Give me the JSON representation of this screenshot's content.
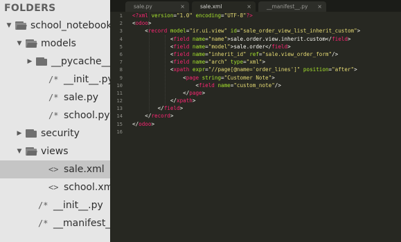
{
  "sidebar": {
    "header": "FOLDERS",
    "items": [
      {
        "label": "school_notebook",
        "type": "folder",
        "expanded": true
      },
      {
        "label": "models",
        "type": "folder",
        "expanded": true
      },
      {
        "label": "__pycache__",
        "type": "folder",
        "expanded": false
      },
      {
        "label": "__init__.py",
        "type": "file",
        "glyph": "/*"
      },
      {
        "label": "sale.py",
        "type": "file",
        "glyph": "/*"
      },
      {
        "label": "school.py",
        "type": "file",
        "glyph": "/*"
      },
      {
        "label": "security",
        "type": "folder",
        "expanded": false
      },
      {
        "label": "views",
        "type": "folder",
        "expanded": true
      },
      {
        "label": "sale.xml",
        "type": "file",
        "glyph": "<>",
        "selected": true
      },
      {
        "label": "school.xml",
        "type": "file",
        "glyph": "<>"
      },
      {
        "label": "__init__.py",
        "type": "file",
        "glyph": "/*"
      },
      {
        "label": "__manifest__.py",
        "type": "file",
        "glyph": "/*"
      }
    ]
  },
  "tabs": [
    {
      "label": "sale.py",
      "close": "×",
      "active": false
    },
    {
      "label": "sale.xml",
      "close": "×",
      "active": true
    },
    {
      "label": "__manifest__.py",
      "close": "×",
      "active": false
    }
  ],
  "editor": {
    "line_numbers": [
      "1",
      "2",
      "3",
      "4",
      "5",
      "6",
      "7",
      "8",
      "9",
      "10",
      "11",
      "12",
      "13",
      "14",
      "15",
      "16"
    ],
    "lines": [
      [
        [
          "tg",
          "<?xml "
        ],
        [
          "at",
          "version"
        ],
        [
          "pu",
          "="
        ],
        [
          "st",
          "\"1.0\""
        ],
        [
          "pu",
          " "
        ],
        [
          "at",
          "encoding"
        ],
        [
          "pu",
          "="
        ],
        [
          "st",
          "\"UTF-8\""
        ],
        [
          "tg",
          "?>"
        ]
      ],
      [
        [
          "pu",
          "<"
        ],
        [
          "tg",
          "odoo"
        ],
        [
          "pu",
          ">"
        ]
      ],
      [
        [
          "pu",
          "    <"
        ],
        [
          "tg",
          "record"
        ],
        [
          "pu",
          " "
        ],
        [
          "at",
          "model"
        ],
        [
          "pu",
          "="
        ],
        [
          "st",
          "\"ir.ui.view\""
        ],
        [
          "pu",
          " "
        ],
        [
          "at",
          "id"
        ],
        [
          "pu",
          "="
        ],
        [
          "st",
          "\"sale_order_view_list_inherit_custom\""
        ],
        [
          "pu",
          ">"
        ]
      ],
      [
        [
          "pu",
          "            <"
        ],
        [
          "tg",
          "field"
        ],
        [
          "pu",
          " "
        ],
        [
          "at",
          "name"
        ],
        [
          "pu",
          "="
        ],
        [
          "st",
          "\"name\""
        ],
        [
          "pu",
          ">sale.order.view.inherit.custom</"
        ],
        [
          "tg",
          "field"
        ],
        [
          "pu",
          ">"
        ]
      ],
      [
        [
          "pu",
          "            <"
        ],
        [
          "tg",
          "field"
        ],
        [
          "pu",
          " "
        ],
        [
          "at",
          "name"
        ],
        [
          "pu",
          "="
        ],
        [
          "st",
          "\"model\""
        ],
        [
          "pu",
          ">sale.order</"
        ],
        [
          "tg",
          "field"
        ],
        [
          "pu",
          ">"
        ]
      ],
      [
        [
          "pu",
          "            <"
        ],
        [
          "tg",
          "field"
        ],
        [
          "pu",
          " "
        ],
        [
          "at",
          "name"
        ],
        [
          "pu",
          "="
        ],
        [
          "st",
          "\"inherit_id\""
        ],
        [
          "pu",
          " "
        ],
        [
          "at",
          "ref"
        ],
        [
          "pu",
          "="
        ],
        [
          "st",
          "\"sale.view_order_form\""
        ],
        [
          "pu",
          "/>"
        ]
      ],
      [
        [
          "pu",
          "            <"
        ],
        [
          "tg",
          "field"
        ],
        [
          "pu",
          " "
        ],
        [
          "at",
          "name"
        ],
        [
          "pu",
          "="
        ],
        [
          "st",
          "\"arch\""
        ],
        [
          "pu",
          " "
        ],
        [
          "at",
          "type"
        ],
        [
          "pu",
          "="
        ],
        [
          "st",
          "\"xml\""
        ],
        [
          "pu",
          ">"
        ]
      ],
      [
        [
          "pu",
          "            <"
        ],
        [
          "tg",
          "xpath"
        ],
        [
          "pu",
          " "
        ],
        [
          "at",
          "expr"
        ],
        [
          "pu",
          "="
        ],
        [
          "st",
          "\"//page[@name='order_lines']\""
        ],
        [
          "pu",
          " "
        ],
        [
          "at",
          "position"
        ],
        [
          "pu",
          "="
        ],
        [
          "st",
          "\"after\""
        ],
        [
          "pu",
          ">"
        ]
      ],
      [
        [
          "pu",
          "                <"
        ],
        [
          "tg",
          "page"
        ],
        [
          "pu",
          " "
        ],
        [
          "at",
          "string"
        ],
        [
          "pu",
          "="
        ],
        [
          "st",
          "\"Customer Note\""
        ],
        [
          "pu",
          ">"
        ]
      ],
      [
        [
          "pu",
          "                    <"
        ],
        [
          "tg",
          "field"
        ],
        [
          "pu",
          " "
        ],
        [
          "at",
          "name"
        ],
        [
          "pu",
          "="
        ],
        [
          "st",
          "\"custom_note\""
        ],
        [
          "pu",
          "/>"
        ]
      ],
      [
        [
          "pu",
          "                </"
        ],
        [
          "tg",
          "page"
        ],
        [
          "pu",
          ">"
        ]
      ],
      [
        [
          "pu",
          "            </"
        ],
        [
          "tg",
          "xpath"
        ],
        [
          "pu",
          ">"
        ]
      ],
      [
        [
          "pu",
          "        </"
        ],
        [
          "tg",
          "field"
        ],
        [
          "pu",
          ">"
        ]
      ],
      [
        [
          "pu",
          "    </"
        ],
        [
          "tg",
          "record"
        ],
        [
          "pu",
          ">"
        ]
      ],
      [
        [
          "pu",
          "</"
        ],
        [
          "tg",
          "odoo"
        ],
        [
          "pu",
          ">"
        ]
      ],
      [
        [
          "pu",
          ""
        ]
      ]
    ]
  }
}
